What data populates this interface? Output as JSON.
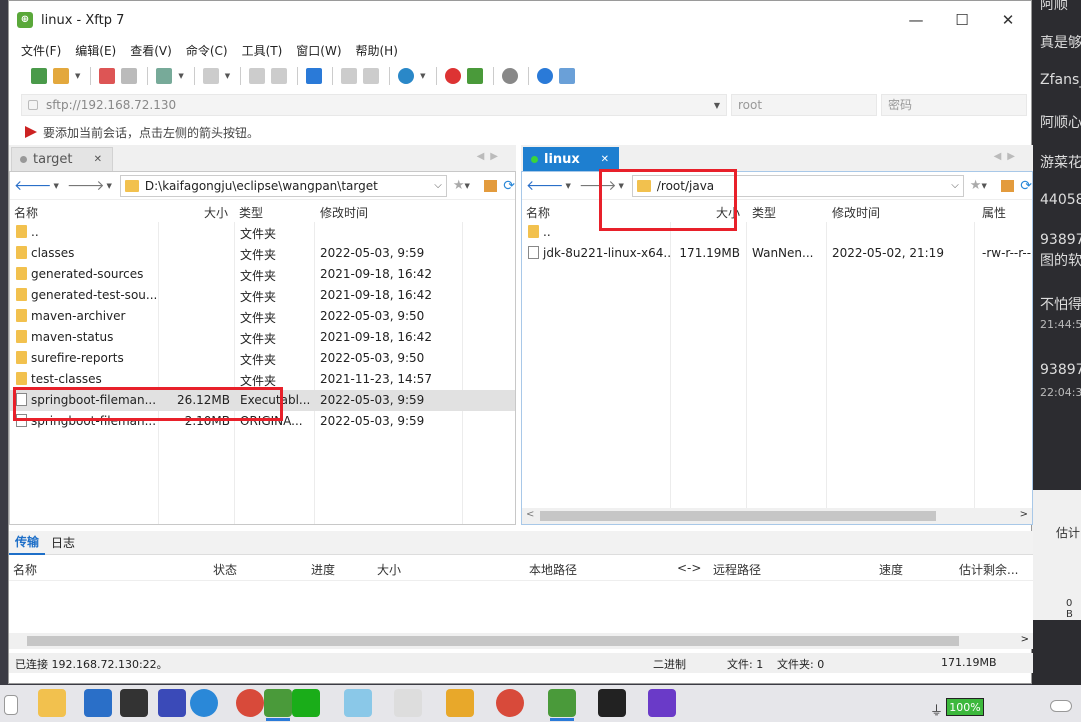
{
  "window": {
    "title": "linux - Xftp 7",
    "minimize": "—",
    "maximize": "☐",
    "close": "✕"
  },
  "menu": [
    "文件(F)",
    "编辑(E)",
    "查看(V)",
    "命令(C)",
    "工具(T)",
    "窗口(W)",
    "帮助(H)"
  ],
  "address": {
    "url": "sftp://192.168.72.130",
    "user_placeholder": "root",
    "pass_placeholder": "密码"
  },
  "hint": "要添加当前会话，点击左侧的箭头按钮。",
  "left": {
    "tab": "target",
    "path": "D:\\kaifagongju\\eclipse\\wangpan\\target",
    "headers": [
      "名称",
      "大小",
      "类型",
      "修改时间"
    ],
    "rows": [
      {
        "name": "..",
        "size": "",
        "type": "文件夹",
        "mtime": "",
        "kind": "folder"
      },
      {
        "name": "classes",
        "size": "",
        "type": "文件夹",
        "mtime": "2022-05-03, 9:59",
        "kind": "folder"
      },
      {
        "name": "generated-sources",
        "size": "",
        "type": "文件夹",
        "mtime": "2021-09-18, 16:42",
        "kind": "folder"
      },
      {
        "name": "generated-test-sou...",
        "size": "",
        "type": "文件夹",
        "mtime": "2021-09-18, 16:42",
        "kind": "folder"
      },
      {
        "name": "maven-archiver",
        "size": "",
        "type": "文件夹",
        "mtime": "2022-05-03, 9:50",
        "kind": "folder"
      },
      {
        "name": "maven-status",
        "size": "",
        "type": "文件夹",
        "mtime": "2021-09-18, 16:42",
        "kind": "folder"
      },
      {
        "name": "surefire-reports",
        "size": "",
        "type": "文件夹",
        "mtime": "2022-05-03, 9:50",
        "kind": "folder"
      },
      {
        "name": "test-classes",
        "size": "",
        "type": "文件夹",
        "mtime": "2021-11-23, 14:57",
        "kind": "folder"
      },
      {
        "name": "springboot-fileman...",
        "size": "26.12MB",
        "type": "Executabl...",
        "mtime": "2022-05-03, 9:59",
        "kind": "file"
      },
      {
        "name": "springboot-fileman...",
        "size": "2.10MB",
        "type": "ORIGINA...",
        "mtime": "2022-05-03, 9:59",
        "kind": "file"
      }
    ]
  },
  "right": {
    "tab": "linux",
    "path": "/root/java",
    "headers": [
      "名称",
      "大小",
      "类型",
      "修改时间",
      "属性"
    ],
    "rows": [
      {
        "name": "..",
        "size": "",
        "type": "",
        "mtime": "",
        "perm": "",
        "kind": "folder"
      },
      {
        "name": "jdk-8u221-linux-x64...",
        "size": "171.19MB",
        "type": "WanNen...",
        "mtime": "2022-05-02, 21:19",
        "perm": "-rw-r--r--",
        "kind": "file"
      }
    ]
  },
  "transfer": {
    "tabs": [
      "传输",
      "日志"
    ],
    "headers": [
      "名称",
      "状态",
      "进度",
      "大小",
      "本地路径",
      "<->",
      "远程路径",
      "速度",
      "估计剩余..."
    ]
  },
  "status": {
    "connected": "已连接 192.168.72.130:22。",
    "mode": "二进制",
    "files": "文件: 1",
    "folders": "文件夹: 0",
    "size": "171.19MB"
  },
  "background": {
    "lines": [
      "阿顺",
      "真是够",
      "Zfans_",
      "阿顺心",
      "游菜花",
      "44058",
      "93897",
      "图的软",
      "不怕得",
      "21:44:5",
      "93897",
      "22:04:3"
    ],
    "panel_label": "估计",
    "panel_small": "0 B"
  },
  "taskbar": {
    "battery": "100%"
  }
}
